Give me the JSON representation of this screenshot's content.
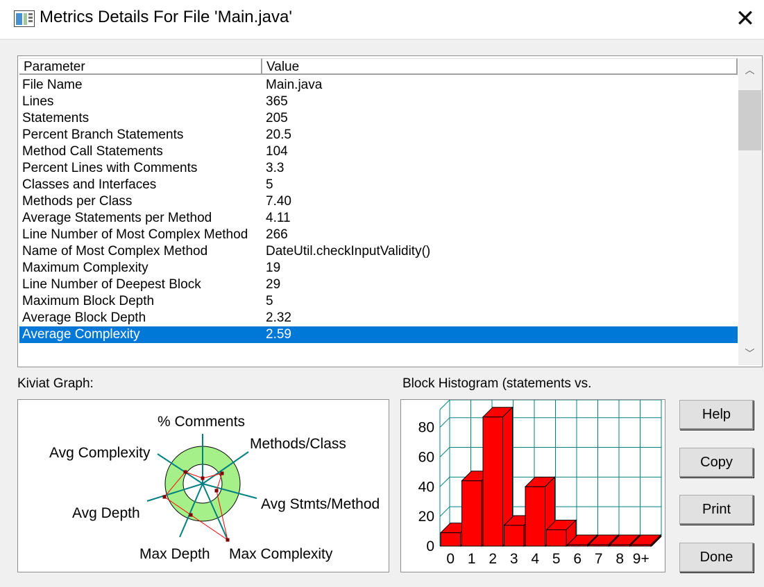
{
  "window": {
    "title": "Metrics Details For File 'Main.java'",
    "app_icon": "metrics-app-icon",
    "close_glyph": "✕"
  },
  "table": {
    "headers": {
      "parameter": "Parameter",
      "value": "Value"
    },
    "rows": [
      {
        "parameter": "File Name",
        "value": "Main.java"
      },
      {
        "parameter": "Lines",
        "value": "365"
      },
      {
        "parameter": "Statements",
        "value": "205"
      },
      {
        "parameter": "Percent Branch Statements",
        "value": "20.5"
      },
      {
        "parameter": "Method Call Statements",
        "value": "104"
      },
      {
        "parameter": "Percent Lines with Comments",
        "value": "3.3"
      },
      {
        "parameter": "Classes and Interfaces",
        "value": "5"
      },
      {
        "parameter": "Methods per Class",
        "value": "7.40"
      },
      {
        "parameter": "Average Statements per Method",
        "value": "4.11"
      },
      {
        "parameter": "Line Number of Most Complex Method",
        "value": "266"
      },
      {
        "parameter": "Name of Most Complex Method",
        "value": "DateUtil.checkInputValidity()"
      },
      {
        "parameter": "Maximum Complexity",
        "value": "19"
      },
      {
        "parameter": "Line Number of Deepest Block",
        "value": "29"
      },
      {
        "parameter": "Maximum Block Depth",
        "value": "5"
      },
      {
        "parameter": "Average Block Depth",
        "value": "2.32"
      },
      {
        "parameter": "Average Complexity",
        "value": "2.59"
      }
    ],
    "selected_row": "Average Complexity",
    "scroll_up_glyph": "︿",
    "scroll_down_glyph": "﹀"
  },
  "kiviat": {
    "label": "Kiviat Graph:",
    "axes": [
      "% Comments",
      "Methods/Class",
      "Avg Stmts/Method",
      "Max Complexity",
      "Max Depth",
      "Avg Depth",
      "Avg Complexity"
    ],
    "colors": {
      "band": "#a6f08a",
      "axis": "#008080",
      "polygon": "#ff0000",
      "marker": "#800000"
    }
  },
  "histogram": {
    "label": "Block Histogram (statements vs.",
    "colors": {
      "bar": "#ff0000",
      "grid": "#008080"
    }
  },
  "chart_data": {
    "type": "bar",
    "title": "Block Histogram (statements vs.",
    "categories": [
      "0",
      "1",
      "2",
      "3",
      "4",
      "5",
      "6",
      "7",
      "8",
      "9+"
    ],
    "values": [
      9,
      44,
      87,
      14,
      40,
      11,
      0,
      0,
      0,
      0
    ],
    "y_ticks": [
      "0",
      "20",
      "40",
      "60",
      "80"
    ],
    "ylim": [
      0,
      92
    ],
    "grid": true
  },
  "buttons": {
    "help": "Help",
    "copy": "Copy",
    "print": "Print",
    "done": "Done"
  }
}
